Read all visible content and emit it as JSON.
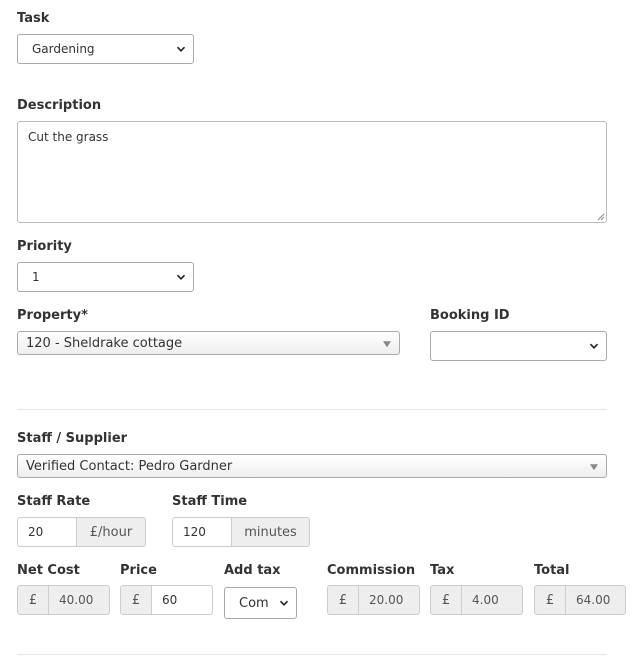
{
  "task": {
    "label": "Task",
    "value": "Gardening"
  },
  "description": {
    "label": "Description",
    "value": "Cut the grass"
  },
  "priority": {
    "label": "Priority",
    "value": "1"
  },
  "property": {
    "label": "Property*",
    "value": "120 - Sheldrake cottage"
  },
  "booking": {
    "label": "Booking ID",
    "value": ""
  },
  "staff": {
    "label": "Staff / Supplier",
    "value": "Verified Contact: Pedro Gardner"
  },
  "staff_rate": {
    "label": "Staff Rate",
    "value": "20",
    "unit": "£/hour"
  },
  "staff_time": {
    "label": "Staff Time",
    "value": "120",
    "unit": "minutes"
  },
  "costs": {
    "currency": "£",
    "net_cost": {
      "label": "Net Cost",
      "value": "40.00"
    },
    "price": {
      "label": "Price",
      "value": "60"
    },
    "add_tax": {
      "label": "Add tax",
      "value": "Com"
    },
    "commission": {
      "label": "Commission",
      "value": "20.00"
    },
    "tax": {
      "label": "Tax",
      "value": "4.00"
    },
    "total": {
      "label": "Total",
      "value": "64.00"
    }
  }
}
